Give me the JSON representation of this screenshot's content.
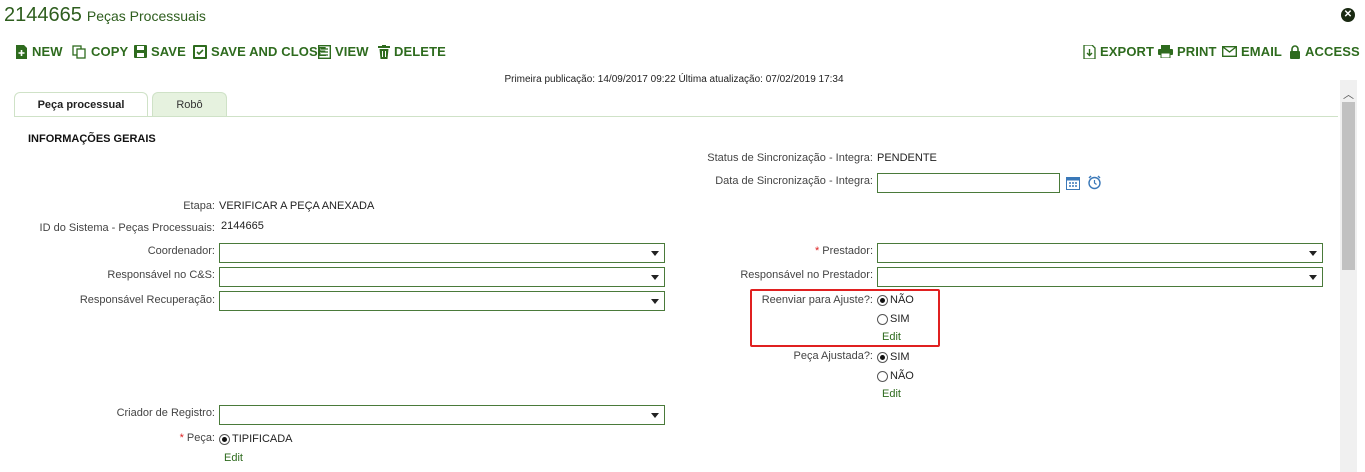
{
  "header": {
    "record_id": "2144665",
    "title": "Peças Processuais"
  },
  "toolbar": {
    "new": "NEW",
    "copy": "COPY",
    "save": "SAVE",
    "save_and_close": "SAVE AND CLOSE",
    "view": "VIEW",
    "delete": "DELETE",
    "export": "EXPORT",
    "print": "PRINT",
    "email": "EMAIL",
    "access": "ACCESS"
  },
  "publication_info": "Primeira publicação: 14/09/2017 09:22 Última atualização: 07/02/2019 17:34",
  "tabs": [
    {
      "label": "Peça processual",
      "active": true
    },
    {
      "label": "Robô",
      "active": false
    }
  ],
  "section": {
    "title": "INFORMAÇÕES GERAIS"
  },
  "fields": {
    "status_sync": {
      "label": "Status de Sincronização - Integra:",
      "value": "PENDENTE"
    },
    "data_sync": {
      "label": "Data de Sincronização - Integra:",
      "value": ""
    },
    "etapa": {
      "label": "Etapa:",
      "value": "VERIFICAR A PEÇA ANEXADA"
    },
    "id_sistema": {
      "label": "ID do Sistema - Peças Processuais:",
      "value": "2144665"
    },
    "coordenador": {
      "label": "Coordenador:",
      "value": ""
    },
    "prestador": {
      "label": "Prestador:",
      "value": "",
      "required": true
    },
    "resp_cs": {
      "label": "Responsável no C&S:",
      "value": ""
    },
    "resp_prestador": {
      "label": "Responsável no Prestador:",
      "value": ""
    },
    "resp_recuperacao": {
      "label": "Responsável Recuperação:",
      "value": ""
    },
    "reenviar_ajuste": {
      "label": "Reenviar para Ajuste?:",
      "options": [
        "NÃO",
        "SIM"
      ],
      "selected": "NÃO",
      "edit_label": "Edit"
    },
    "peca_ajustada": {
      "label": "Peça Ajustada?:",
      "options": [
        "SIM",
        "NÃO"
      ],
      "selected": "SIM",
      "edit_label": "Edit"
    },
    "criador_registro": {
      "label": "Criador de Registro:",
      "value": ""
    },
    "peca": {
      "label": "Peça:",
      "options": [
        "TIPIFICADA"
      ],
      "selected": "TIPIFICADA",
      "edit_label": "Edit",
      "required": true
    }
  },
  "colors": {
    "brand_green": "#2e6b1e",
    "highlight_red": "#e02020",
    "tab_active_bg": "#ffffff",
    "tab_inactive_bg": "#e6f2df"
  }
}
